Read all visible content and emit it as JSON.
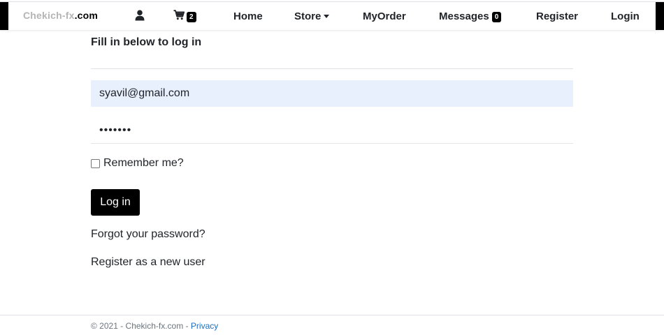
{
  "navbar": {
    "brand_name": "Chekich-fx",
    "brand_tld": ".com",
    "cart_count": "2",
    "links": {
      "home": "Home",
      "store": "Store",
      "my_order": "MyOrder",
      "messages": "Messages",
      "register": "Register",
      "login": "Login"
    },
    "messages_count": "0",
    "icons": {
      "user": "user-icon",
      "cart": "shopping-cart-icon",
      "store_dropdown": "caret-down-icon"
    }
  },
  "login_form": {
    "heading": "Fill in below to log in",
    "email_value": "syavil@gmail.com",
    "password_mask": "•••••••",
    "remember_label": "Remember me?",
    "remember_checked": false,
    "submit_label": "Log in",
    "forgot_password": "Forgot your password?",
    "register_link": "Register as a new user"
  },
  "footer": {
    "copyright": "© 2021 - Chekich-fx.com -",
    "privacy": "Privacy"
  },
  "colors": {
    "accent": "#000000",
    "autofill_background": "#e8f0fe",
    "link": "#1b6ec2",
    "brand_gray": "#b5b5b5"
  }
}
